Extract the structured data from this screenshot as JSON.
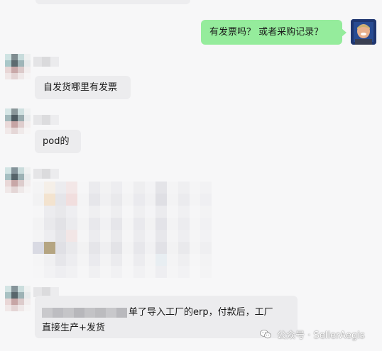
{
  "messages": {
    "outgoing_1": "有发票吗？ 或者采购记录？",
    "incoming_1": "自发货哪里有发票",
    "incoming_2": "pod的",
    "incoming_4_line1": "单了导入工厂的erp，付款后，工厂",
    "incoming_4_line2": "直接生产+发货"
  },
  "watermark": {
    "icon": "wechat-icon",
    "text": "公众号 · SellerAegis"
  },
  "colors": {
    "background": "#f7f7f8",
    "outgoing_bubble": "#95ec9c",
    "incoming_bubble": "#ececee"
  }
}
